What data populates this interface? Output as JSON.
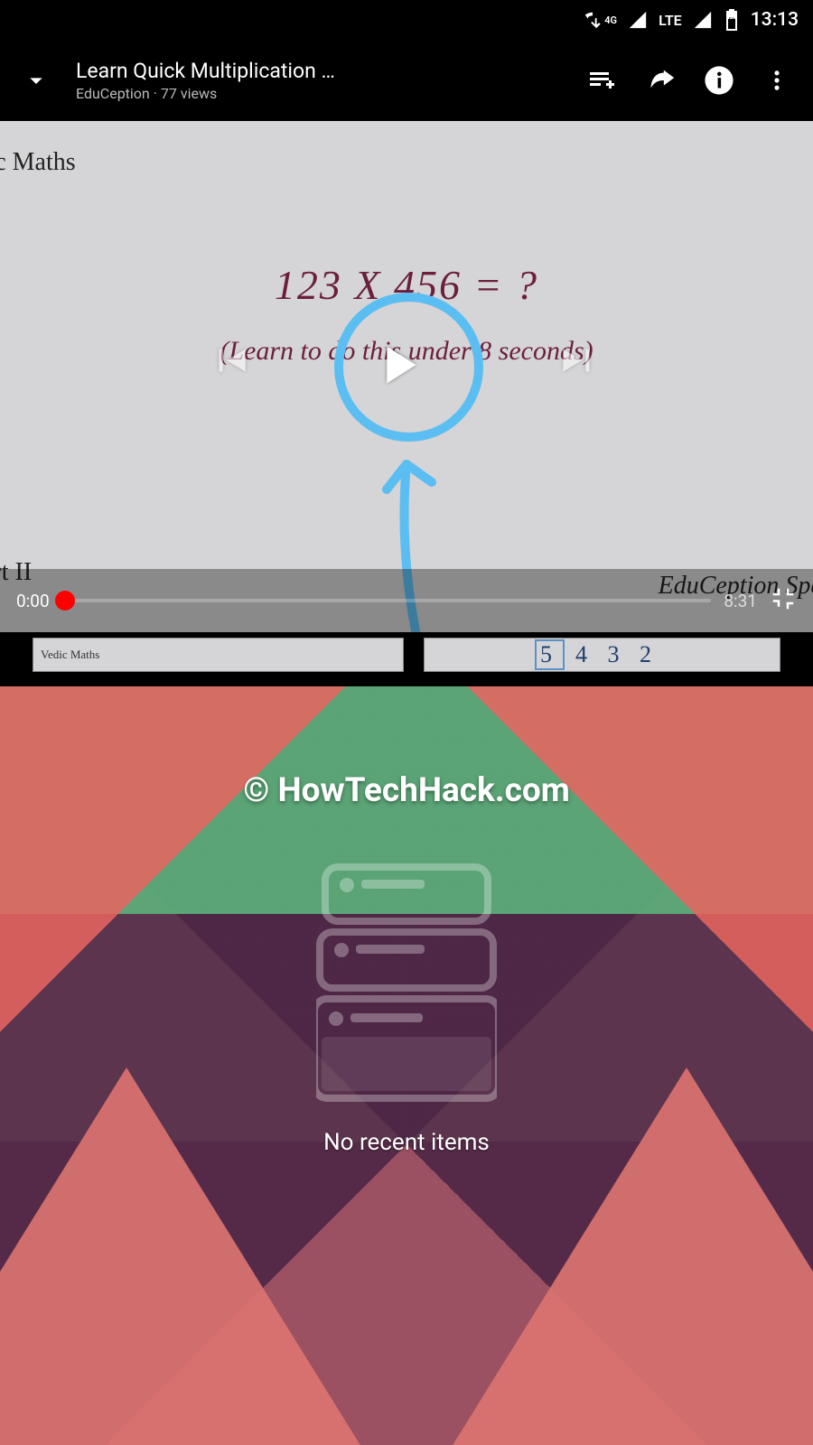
{
  "status": {
    "net_label": "4G",
    "lte_label": "LTE",
    "battery_level": "59",
    "time": "13:13"
  },
  "header": {
    "title": "Learn Quick Multiplication …",
    "subtitle": "EduCeption · 77 views"
  },
  "video": {
    "top_left_text": "edic Maths",
    "equation": "123 X 456 = ?",
    "subtitle": "(Learn to do this under 8 seconds)",
    "bottom_left": "art II",
    "bottom_right": "EduCeption Speci",
    "current_time": "0:00",
    "total_time": "8:31"
  },
  "thumbs": {
    "first_label": "Vedic Maths",
    "second_numbers": "5432"
  },
  "recents": {
    "watermark": "© HowTechHack.com",
    "empty_text": "No recent items"
  },
  "colors": {
    "annotation": "#5bbef2",
    "accent_red": "#f00"
  }
}
